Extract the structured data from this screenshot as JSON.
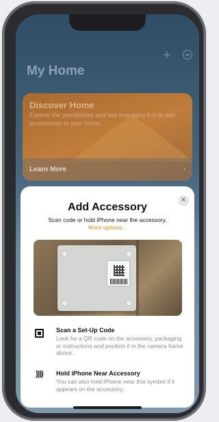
{
  "home": {
    "title": "My Home",
    "add_icon": "plus-icon",
    "more_icon": "circle-minus-icon"
  },
  "banner": {
    "title": "Discover Home",
    "text": "Explore the possibilities and see how easy it is to add accessories to your home.",
    "learn_more": "Learn More"
  },
  "sheet": {
    "title": "Add Accessory",
    "subtitle": "Scan code or hold iPhone near the accessory.",
    "more_options": "More options...",
    "items": [
      {
        "icon": "qr-code-icon",
        "title": "Scan a Set-Up Code",
        "desc": "Look for a QR code on the accessory, packaging or instructions and position it in the camera frame above."
      },
      {
        "icon": "nfc-icon",
        "title": "Hold iPhone Near Accessory",
        "desc": "You can also hold iPhone near this symbol if it appears on the accessory."
      }
    ]
  },
  "colors": {
    "accent": "#c9921c",
    "sheet_bg": "#ffffff"
  }
}
